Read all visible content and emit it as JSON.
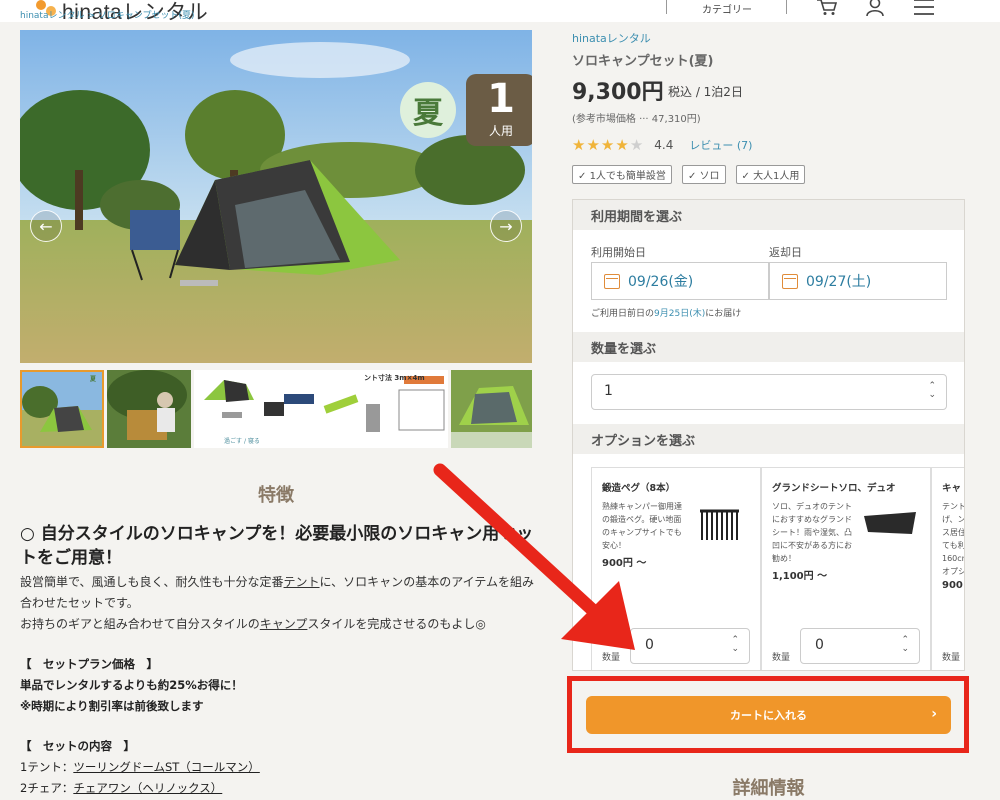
{
  "header": {
    "logo_text": "hinataレンタル",
    "category_label": "カテゴリー",
    "icons": [
      "cart-icon",
      "user-icon",
      "menu-icon"
    ]
  },
  "breadcrumb": {
    "text": "hinataレンタル > ソロキャンプセット(夏)"
  },
  "gallery": {
    "season_badge": "夏",
    "person_count": "1",
    "person_unit": "人用",
    "prev_icon": "arrow-left-icon",
    "next_icon": "arrow-right-icon",
    "thumbnails": [
      {
        "caption": "夏"
      },
      {
        "caption": ""
      },
      {
        "caption": "過ごす / 寝る"
      },
      {
        "caption": "ント寸法 3m×4m"
      },
      {
        "caption": ""
      }
    ]
  },
  "features": {
    "section_title": "特徴",
    "lead": "○ 自分スタイルのソロキャンプを！必要最小限のソロキャン用セットをご用意！",
    "paragraph_1_a": "設営簡単で、風通しも良く、耐久性も十分な定番",
    "paragraph_1_link": "テント",
    "paragraph_1_b": "に、ソロキャンの基本のアイテムを組み合わせたセットです。",
    "paragraph_2_a": "お持ちのギアと組み合わせて自分スタイルの",
    "paragraph_2_link": "キャンプ",
    "paragraph_2_b": "スタイルを完成させるのもよし◎",
    "plan_heading": "【　セットプラン価格　】",
    "plan_line_1": "単品でレンタルするよりも約25%お得に！",
    "plan_line_2": "※時期により割引率は前後致します",
    "contents_heading": "【　セットの内容　】",
    "contents": [
      {
        "prefix": "1テント：",
        "item": "ツーリングドームST（コールマン）"
      },
      {
        "prefix": "2チェア：",
        "item": "チェアワン（ヘリノックス）"
      }
    ]
  },
  "product": {
    "shop_link": "hinataレンタル",
    "title": "ソロキャンプセット(夏)",
    "price": "9,300円",
    "price_note": "税込 / 1泊2日",
    "reference_price": "(参考市場価格 ··· 47,310円)",
    "rating_value": "4.4",
    "review_link": "レビュー (7)",
    "stars_filled": 4,
    "stars_total": 5,
    "tags": [
      "1人でも簡単設営",
      "ソロ",
      "大人1人用"
    ],
    "accent_color": "#f0962a",
    "link_color": "#3d8fb0"
  },
  "booking": {
    "period_heading": "利用期間を選ぶ",
    "start_label": "利用開始日",
    "start_value": "09/26(金)",
    "return_label": "返却日",
    "return_value": "09/27(土)",
    "delivery_prefix": "ご利用日前日の",
    "delivery_date": "9月25日(木)",
    "delivery_suffix": "にお届け",
    "quantity_heading": "数量を選ぶ",
    "quantity_value": "1",
    "options_heading": "オプションを選ぶ",
    "options": [
      {
        "name": "鍛造ペグ（8本）",
        "desc": "熟練キャンパー御用達の鍛造ペグ。硬い地面のキャンプサイトでも安心！",
        "price": "900円 〜",
        "qty_label": "数量",
        "qty_value": "0"
      },
      {
        "name": "グランドシートソロ、デュオ",
        "desc": "ソロ、デュオのテントにおすすめなグランドシート！雨や湿気、凸凹に不安がある方にお勧め！",
        "price": "1,100円 〜",
        "qty_label": "数量",
        "qty_value": "0"
      },
      {
        "name": "キャ",
        "desc": "テント上げ、ングス居住性ても利160cmオプシ",
        "price": "900",
        "qty_label": "数量",
        "qty_value": ""
      }
    ],
    "cart_button": "カートに入れる",
    "detail_heading": "詳細情報"
  },
  "annotation": {
    "highlight_color": "#e8261a"
  }
}
